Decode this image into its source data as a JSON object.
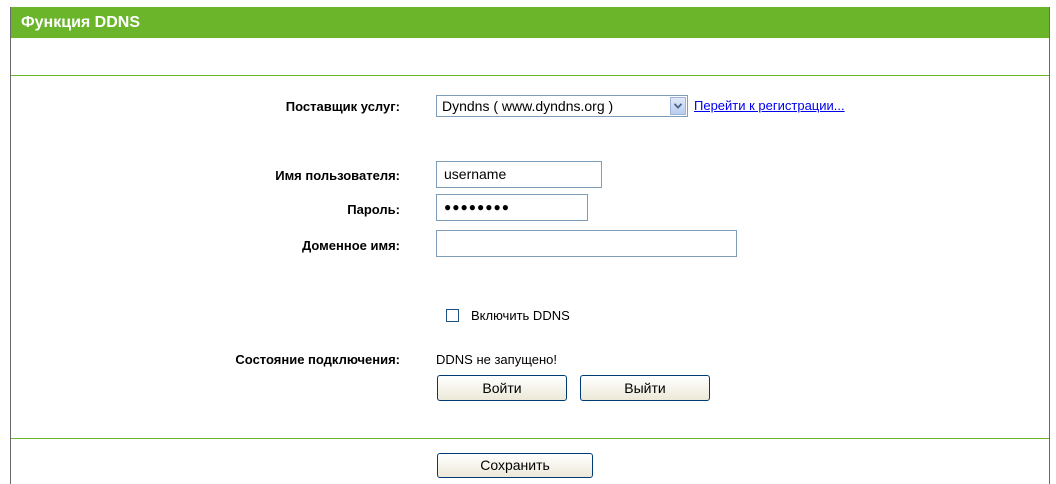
{
  "page": {
    "title": "Функция DDNS"
  },
  "provider": {
    "label": "Поставщик услуг:",
    "selected": "Dyndns ( www.dyndns.org )",
    "register_link": "Перейти к регистрации..."
  },
  "username": {
    "label": "Имя пользователя:",
    "value": "username"
  },
  "password": {
    "label": "Пароль:",
    "value": "●●●●●●●●"
  },
  "domain": {
    "label": "Доменное имя:",
    "value": ""
  },
  "enable_ddns": {
    "label": "Включить DDNS",
    "checked": false
  },
  "connection": {
    "label": "Состояние подключения:",
    "status": "DDNS не запущено!"
  },
  "buttons": {
    "login": "Войти",
    "logout": "Выйти",
    "save": "Сохранить"
  },
  "colors": {
    "accent": "#6bb52b",
    "link": "#0000ee"
  }
}
